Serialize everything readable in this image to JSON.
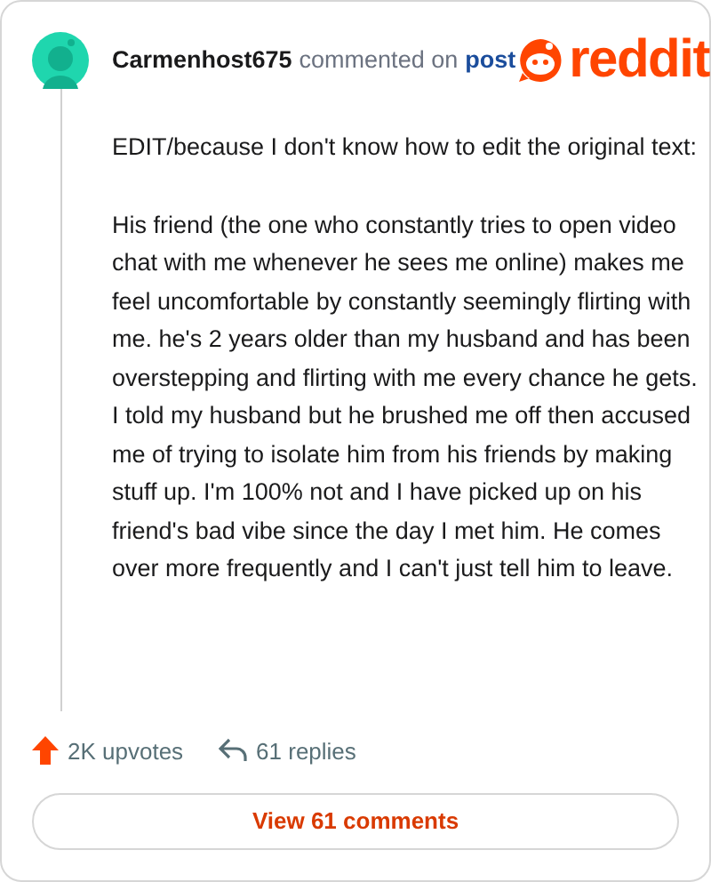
{
  "header": {
    "username": "Carmenhost675",
    "action": "commented on",
    "link": "post",
    "logo_text": "reddit"
  },
  "paragraphs": [
    "EDIT/because I don't know how to edit the original text:",
    "His friend (the one who constantly tries to open video chat with me whenever he sees me online) makes me feel uncomfortable by constantly seemingly flirting with me. he's 2 years older than my husband and has been overstepping and flirting with me every chance he gets. I told my husband but he brushed me off then accused me of trying to isolate him from his friends by making stuff up. I'm 100% not and I have picked up on his friend's bad vibe since the day I met him. He comes over more frequently and I can't just tell him to leave."
  ],
  "footer": {
    "upvotes": "2K upvotes",
    "replies": "61 replies",
    "button": "View 61 comments"
  }
}
